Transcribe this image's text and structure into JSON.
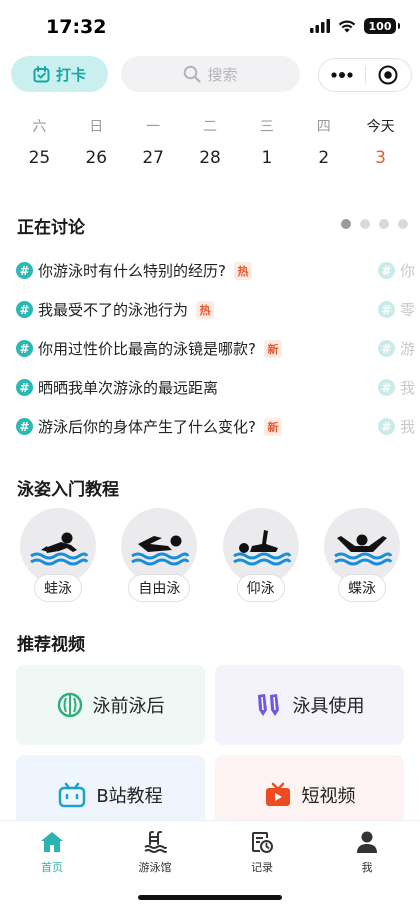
{
  "status": {
    "time": "17:32",
    "battery": "100"
  },
  "header": {
    "checkin_label": "打卡",
    "search_placeholder": "搜索"
  },
  "week": {
    "weekdays": [
      "六",
      "日",
      "一",
      "二",
      "三",
      "四",
      "今天"
    ],
    "days": [
      "25",
      "26",
      "27",
      "28",
      "1",
      "2",
      "3"
    ],
    "today_index": 6
  },
  "discussion": {
    "title": "正在讨论",
    "pages": 4,
    "active_page": 0,
    "topics": [
      {
        "text": "你游泳时有什么特别的经历?",
        "tag": "热",
        "tag_type": "hot"
      },
      {
        "text": "我最受不了的泳池行为",
        "tag": "热",
        "tag_type": "hot"
      },
      {
        "text": "你用过性价比最高的泳镜是哪款?",
        "tag": "新",
        "tag_type": "new"
      },
      {
        "text": "晒晒我单次游泳的最远距离",
        "tag": "",
        "tag_type": ""
      },
      {
        "text": "游泳后你的身体产生了什么变化?",
        "tag": "新",
        "tag_type": "new"
      }
    ],
    "next_column": [
      "你",
      "零",
      "游",
      "我",
      "我"
    ]
  },
  "strokes": {
    "title": "泳姿入门教程",
    "items": [
      {
        "label": "蛙泳",
        "icon": "breaststroke-icon"
      },
      {
        "label": "自由泳",
        "icon": "freestyle-icon"
      },
      {
        "label": "仰泳",
        "icon": "backstroke-icon"
      },
      {
        "label": "蝶泳",
        "icon": "butterfly-icon"
      }
    ]
  },
  "videos": {
    "title": "推荐视频",
    "cards": [
      {
        "label": "泳前泳后",
        "icon": "ball-icon",
        "bg": "#eff8f4"
      },
      {
        "label": "泳具使用",
        "icon": "fins-icon",
        "bg": "#f4f3fb"
      },
      {
        "label": "B站教程",
        "icon": "bilibili-icon",
        "bg": "#eef5fc"
      },
      {
        "label": "短视频",
        "icon": "tv-icon",
        "bg": "#fdf3f2"
      }
    ]
  },
  "tabs": [
    {
      "label": "首页",
      "icon": "home-icon",
      "active": true
    },
    {
      "label": "游泳馆",
      "icon": "pool-icon",
      "active": false
    },
    {
      "label": "记录",
      "icon": "record-icon",
      "active": false
    },
    {
      "label": "我",
      "icon": "profile-icon",
      "active": false
    }
  ],
  "colors": {
    "accent": "#2bb5b0",
    "today": "#ec5a2c",
    "tag": "#e8572a"
  }
}
